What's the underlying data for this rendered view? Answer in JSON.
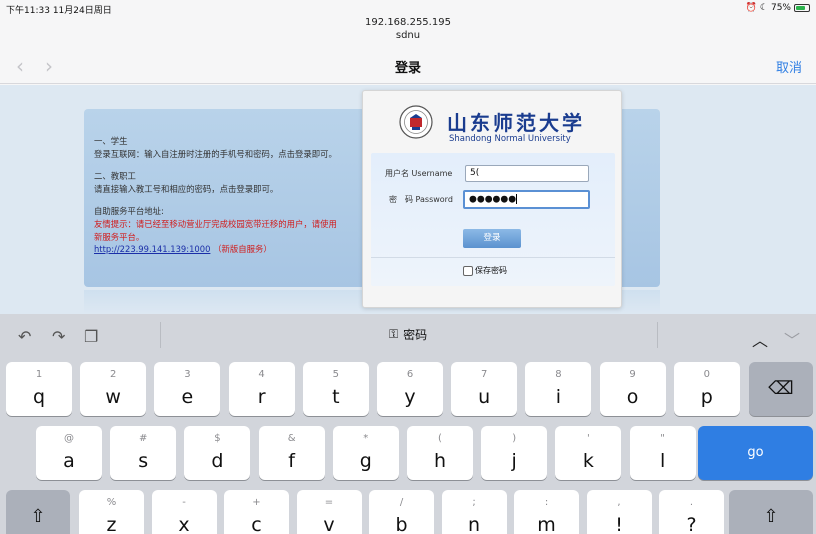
{
  "status_bar": {
    "time": "下午11:33",
    "date": "11月24日周日",
    "battery_percent": "75%",
    "battery_level": 0.75,
    "icons": [
      "alarm-icon",
      "moon-icon",
      "battery-icon"
    ]
  },
  "browser": {
    "url": "192.168.255.195",
    "site_name": "sdnu",
    "page_title": "登录",
    "cancel": "取消",
    "back_icon": "‹",
    "forward_icon": "›"
  },
  "info": {
    "student_heading": "一、学生",
    "student_text": "登录互联网：输入自注册时注册的手机号和密码，点击登录即可。",
    "staff_heading": "二、教职工",
    "staff_text": "请直接输入教工号和相应的密码，点击登录即可。",
    "selfservice_heading": "自助服务平台地址:",
    "notice_line1": "友情提示：请已经至移动营业厅完成校园宽带迁移的用户，请使用",
    "notice_line2": "新服务平台。",
    "link": "http://223.99.141.139:1000",
    "link_note": "（新版自服务）"
  },
  "login": {
    "university_cn": "山东师范大学",
    "university_en": "Shandong Normal University",
    "username_label": "用户名 Username",
    "username_value": "5(",
    "password_label": "密　码 Password",
    "password_value": "●●●●●●",
    "login_button": "登录",
    "remember": "保存密码"
  },
  "keyboard": {
    "toolbar_center": "密码",
    "row1": [
      {
        "k": "q",
        "h": "1"
      },
      {
        "k": "w",
        "h": "2"
      },
      {
        "k": "e",
        "h": "3"
      },
      {
        "k": "r",
        "h": "4"
      },
      {
        "k": "t",
        "h": "5"
      },
      {
        "k": "y",
        "h": "6"
      },
      {
        "k": "u",
        "h": "7"
      },
      {
        "k": "i",
        "h": "8"
      },
      {
        "k": "o",
        "h": "9"
      },
      {
        "k": "p",
        "h": "0"
      }
    ],
    "row2": [
      {
        "k": "a",
        "h": "@"
      },
      {
        "k": "s",
        "h": "#"
      },
      {
        "k": "d",
        "h": "$"
      },
      {
        "k": "f",
        "h": "&"
      },
      {
        "k": "g",
        "h": "*"
      },
      {
        "k": "h",
        "h": "("
      },
      {
        "k": "j",
        "h": ")"
      },
      {
        "k": "k",
        "h": "'"
      },
      {
        "k": "l",
        "h": "\""
      }
    ],
    "row3": [
      {
        "k": "z",
        "h": "%"
      },
      {
        "k": "x",
        "h": "-"
      },
      {
        "k": "c",
        "h": "+"
      },
      {
        "k": "v",
        "h": "="
      },
      {
        "k": "b",
        "h": "/"
      },
      {
        "k": "n",
        "h": ";"
      },
      {
        "k": "m",
        "h": ":"
      },
      {
        "k": "!",
        "h": ","
      },
      {
        "k": "?",
        "h": "."
      }
    ],
    "go": "go"
  }
}
